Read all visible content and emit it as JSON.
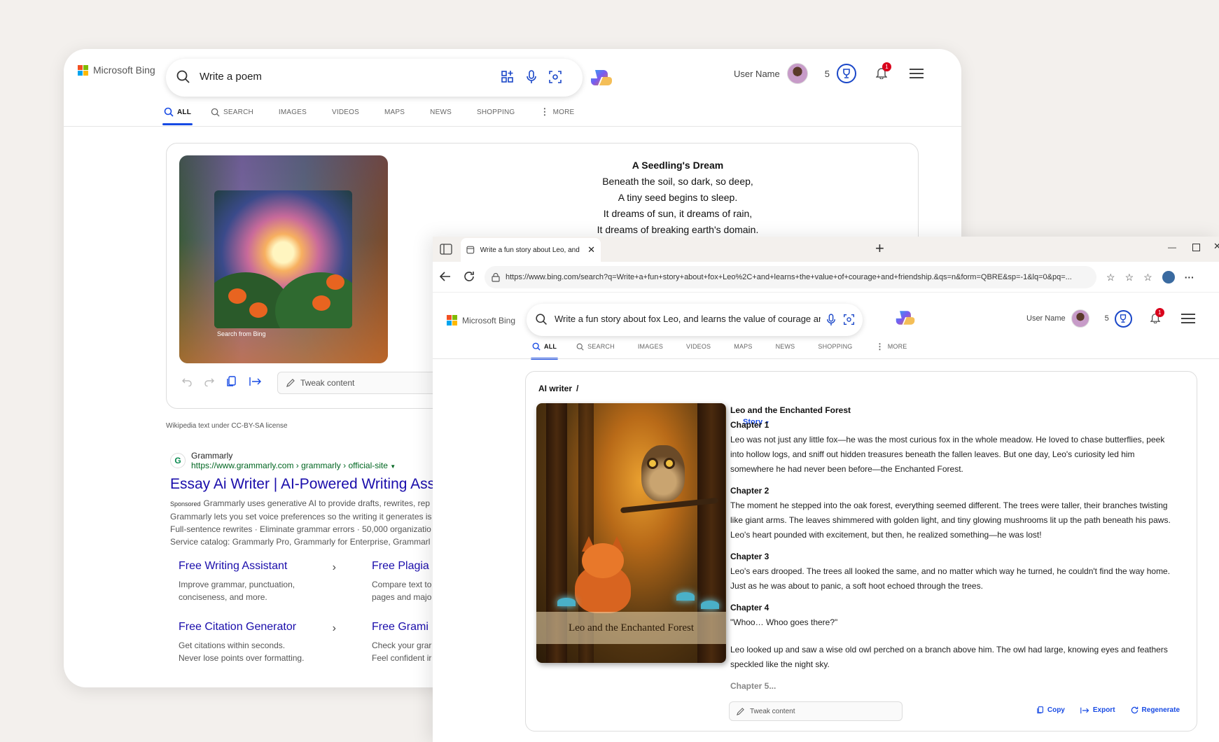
{
  "back": {
    "logo": "Microsoft Bing",
    "search_query": "Write a poem",
    "user_name": "User Name",
    "points": "5",
    "notif_count": "1",
    "tabs": [
      "ALL",
      "SEARCH",
      "IMAGES",
      "VIDEOS",
      "MAPS",
      "NEWS",
      "SHOPPING",
      "MORE"
    ],
    "image_caption": "Search from Bing",
    "poem": {
      "title": "A Seedling's Dream",
      "lines": [
        "Beneath the soil, so dark, so deep,",
        "A tiny seed begins to sleep.",
        "It dreams of sun, it dreams of rain,",
        "It dreams of breaking earth's domain."
      ]
    },
    "tweak_placeholder": "Tweak content",
    "license": "Wikipedia text under CC-BY-SA license",
    "ad": {
      "brand": "Grammarly",
      "url": "https://www.grammarly.com › grammarly › official-site",
      "title": "Essay Ai Writer | AI-Powered Writing Assi",
      "sponsored": "Sponsored",
      "desc_lines": [
        "Grammarly uses generative AI to provide drafts, rewrites, rep",
        "Grammarly lets you set voice preferences so the writing it generates is",
        "Full-sentence rewrites · Eliminate grammar errors · 50,000 organizatio",
        "Service catalog: Grammarly Pro, Grammarly for Enterprise, Grammarl"
      ]
    },
    "sitelinks": [
      {
        "title": "Free Writing Assistant",
        "l1": "Improve grammar, punctuation,",
        "l2": "conciseness, and more."
      },
      {
        "title": "Free Plagia",
        "l1": "Compare text to",
        "l2": "pages and majo"
      },
      {
        "title": "Free Citation Generator",
        "l1": "Get citations within seconds.",
        "l2": "Never lose points over formatting."
      },
      {
        "title": "Free Grami",
        "l1": "Check your grar",
        "l2": "Feel confident ir"
      }
    ]
  },
  "front": {
    "tab_title": "Write a fun story about Leo, and le",
    "url": "https://www.bing.com/search?q=Write+a+fun+story+about+fox+Leo%2C+and+learns+the+value+of+courage+and+friendship.&qs=n&form=QBRE&sp=-1&lq=0&pq=...",
    "logo": "Microsoft Bing",
    "search_query": "Write a fun story about fox Leo, and learns the value of courage and friends",
    "user_name": "User Name",
    "points": "5",
    "notif_count": "1",
    "tabs": [
      "ALL",
      "SEARCH",
      "IMAGES",
      "VIDEOS",
      "MAPS",
      "NEWS",
      "SHOPPING",
      "MORE"
    ],
    "crumb_root": "AI writer",
    "crumb_sep": "/",
    "crumb_type": "Story",
    "book_title": "Leo and the Enchanted Forest",
    "story": {
      "title": "Leo and the Enchanted Forest",
      "ch1_h": "Chapter 1",
      "ch1": "Leo was not just any little fox—he was the most curious fox in the whole meadow. He loved to chase butterflies, peek into hollow logs, and sniff out hidden treasures beneath the fallen leaves. But one day, Leo's curiosity led him somewhere he had never been before—the Enchanted Forest.",
      "ch2_h": "Chapter 2",
      "ch2": "The moment he stepped into the oak forest, everything seemed different. The trees were taller, their branches twisting like giant arms. The leaves shimmered with golden light, and tiny glowing mushrooms lit up the path beneath his paws. Leo's heart pounded with excitement, but then, he realized something—he was lost!",
      "ch3_h": "Chapter 3",
      "ch3": "Leo's ears drooped. The trees all looked the same, and no matter which way he turned, he couldn't find the way home. Just as he was about to panic, a soft hoot echoed through the trees.",
      "ch4_h": "Chapter 4",
      "ch4a": "\"Whoo… Whoo goes there?\"",
      "ch4b": "Leo looked up and saw a wise old owl perched on a branch above him. The owl had large, knowing eyes and feathers speckled like the night sky.",
      "ch5_h": "Chapter 5..."
    },
    "tweak_placeholder": "Tweak content",
    "actions": {
      "copy": "Copy",
      "export": "Export",
      "regenerate": "Regenerate"
    }
  }
}
